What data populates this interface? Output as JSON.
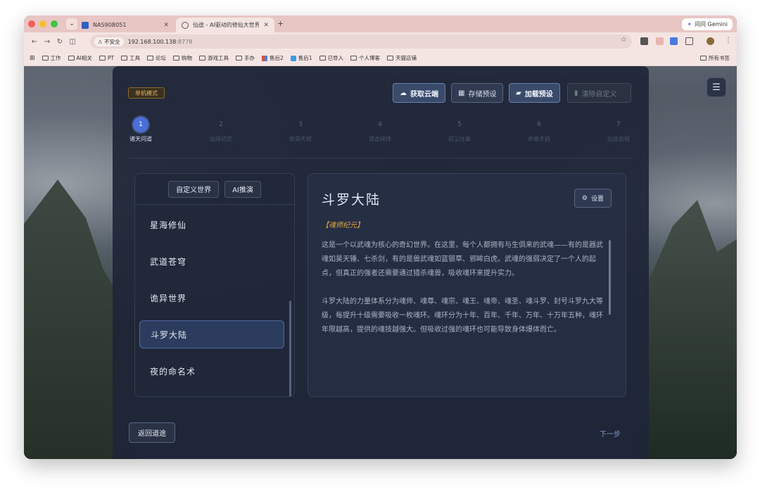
{
  "browser": {
    "tabs": [
      {
        "title": "NAS90B051"
      },
      {
        "title": "仙途 - AI驱动的修仙大世界 | AI"
      }
    ],
    "gemini_label": "问问 Gemini",
    "security_label": "不安全",
    "url_host": "192.168.100.138",
    "url_port": ":8778",
    "bookmarks": [
      "工作",
      "AI相关",
      "PT",
      "工具",
      "论坛",
      "购物",
      "游戏工具",
      "手办",
      "售后2",
      "售后1",
      "已导入",
      "个人博客",
      "天猫店铺"
    ],
    "bookmarks_right": "所有书签"
  },
  "app": {
    "mode_badge": "单机模式",
    "toolbar": {
      "fetch_cloud": "获取云端",
      "save_preset": "存储预设",
      "load_preset": "加载预设",
      "clear_custom": "清除自定义"
    },
    "steps": [
      {
        "num": "1",
        "label": "诸天问道"
      },
      {
        "num": "2",
        "label": "仙缘初定"
      },
      {
        "num": "3",
        "label": "根骨天赋"
      },
      {
        "num": "4",
        "label": "道途抉择"
      },
      {
        "num": "5",
        "label": "前尘往事"
      },
      {
        "num": "6",
        "label": "命格天启"
      },
      {
        "num": "7",
        "label": "仙途启程"
      }
    ],
    "world_tabs": {
      "custom": "自定义世界",
      "ai": "AI推演"
    },
    "worlds": [
      "星海修仙",
      "武道苍穹",
      "诡异世界",
      "斗罗大陆",
      "夜的命名术"
    ],
    "selected_world": "斗罗大陆",
    "detail": {
      "title": "斗罗大陆",
      "settings_label": "设置",
      "era": "【魂师纪元】",
      "paragraphs": [
        "这是一个以武魂为核心的奇幻世界。在这里，每个人都拥有与生俱来的武魂——有的是器武魂如昊天锤、七杀剑，有的是兽武魂如蓝银草、邪眸白虎。武魂的强弱决定了一个人的起点，但真正的强者还需要通过猎杀魂兽，吸收魂环来提升实力。",
        "斗罗大陆的力量体系分为魂师、魂尊、魂宗、魂王、魂帝、魂圣、魂斗罗、封号斗罗九大等级，每提升十级需要吸收一枚魂环。魂环分为十年、百年、千年、万年、十万年五种，魂环年限越高，提供的魂技越强大。但吸收过强的魂环也可能导致身体爆体而亡。"
      ]
    },
    "back_label": "返回道途",
    "next_label": "下一步"
  }
}
